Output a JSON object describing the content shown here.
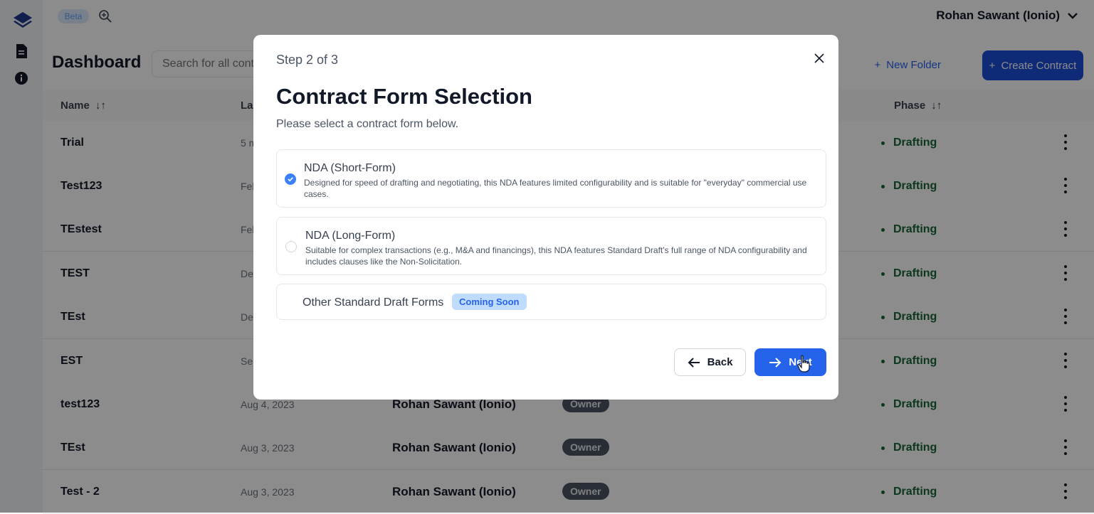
{
  "topbar": {
    "beta_label": "Beta",
    "user_name": "Rohan Sawant (Ionio)"
  },
  "header": {
    "title": "Dashboard",
    "search_placeholder": "Search for all contracts",
    "new_folder_label": "New Folder",
    "create_contract_label": "Create Contract"
  },
  "table": {
    "columns": {
      "name": "Name",
      "last_modified": "Last Modified",
      "phase": "Phase"
    },
    "rows": [
      {
        "name": "Trial",
        "date": "5 m",
        "owner": "",
        "role": "",
        "phase": "Drafting"
      },
      {
        "name": "Test123",
        "date": "Feb",
        "owner": "",
        "role": "",
        "phase": "Drafting"
      },
      {
        "name": "TEstest",
        "date": "Feb",
        "owner": "",
        "role": "",
        "phase": "Drafting"
      },
      {
        "name": "TEST",
        "date": "Dec",
        "owner": "",
        "role": "",
        "phase": "Drafting"
      },
      {
        "name": "TEst",
        "date": "Dec",
        "owner": "",
        "role": "",
        "phase": "Drafting"
      },
      {
        "name": "EST",
        "date": "Sep",
        "owner": "",
        "role": "",
        "phase": "Drafting"
      },
      {
        "name": "test123",
        "date": "Aug 4, 2023",
        "owner": "Rohan Sawant (Ionio)",
        "role": "Owner",
        "phase": "Drafting"
      },
      {
        "name": "TEst",
        "date": "Aug 3, 2023",
        "owner": "Rohan Sawant (Ionio)",
        "role": "Owner",
        "phase": "Drafting"
      },
      {
        "name": "Test - 2",
        "date": "Aug 3, 2023",
        "owner": "Rohan Sawant (Ionio)",
        "role": "Owner",
        "phase": "Drafting"
      }
    ]
  },
  "modal": {
    "step": "Step 2 of 3",
    "title": "Contract Form Selection",
    "subtitle": "Please select a contract form below.",
    "options": [
      {
        "title": "NDA (Short-Form)",
        "description": "Designed for speed of drafting and negotiating, this NDA features limited configurability and is suitable for \"everyday\" commercial use cases.",
        "selected": true
      },
      {
        "title": "NDA (Long-Form)",
        "description": "Suitable for complex transactions (e.g., M&A and financings), this NDA features Standard Draft's full range of NDA configurability and includes clauses like the Non-Solicitation.",
        "selected": false
      },
      {
        "title": "Other Standard Draft Forms",
        "badge": "Coming Soon"
      }
    ],
    "back_label": "Back",
    "next_label": "Next"
  },
  "colors": {
    "primary": "#2563eb",
    "phase_green": "#166534",
    "overlay": "rgba(0,0,0,0.45)"
  }
}
